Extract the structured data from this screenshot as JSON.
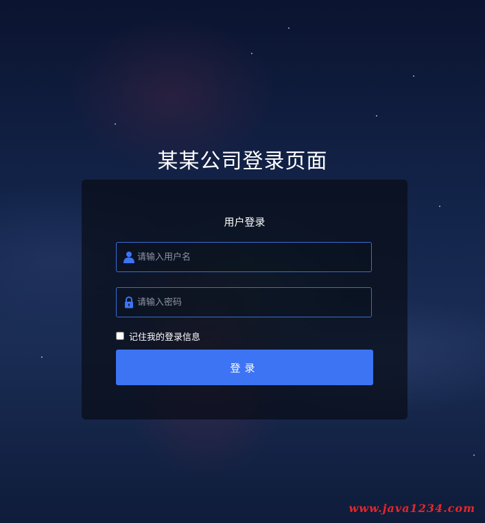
{
  "page": {
    "title": "某某公司登录页面"
  },
  "login": {
    "card_title": "用户登录",
    "username": {
      "placeholder": "请输入用户名",
      "value": "",
      "icon": "user-icon"
    },
    "password": {
      "placeholder": "请输入密码",
      "value": "",
      "icon": "lock-icon"
    },
    "remember_label": "记住我的登录信息",
    "remember_checked": false,
    "submit_label": "登录"
  },
  "watermark": "www.java1234.com",
  "colors": {
    "accent": "#3d74f4",
    "field_border": "#3b6fd8",
    "watermark": "#e8262a"
  }
}
